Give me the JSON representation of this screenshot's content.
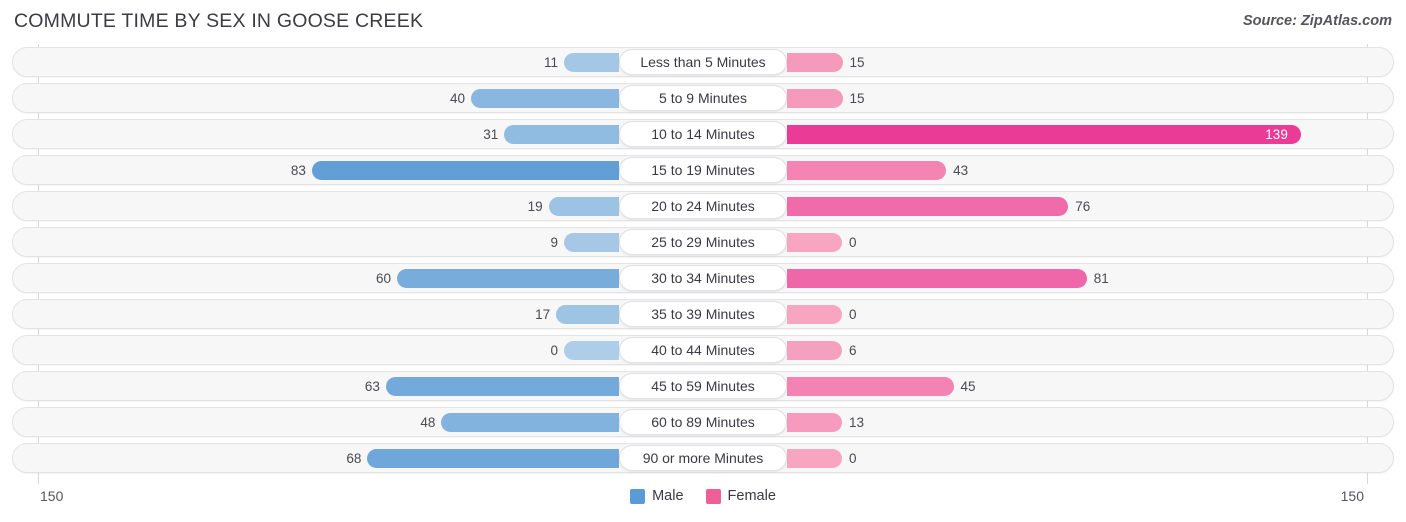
{
  "header": {
    "title": "COMMUTE TIME BY SEX IN GOOSE CREEK",
    "source": "Source: ZipAtlas.com"
  },
  "footer": {
    "axis_left": "150",
    "axis_right": "150"
  },
  "legend": [
    {
      "label": "Male",
      "color": "#5b9bd5"
    },
    {
      "label": "Female",
      "color": "#ef5f97"
    }
  ],
  "chart_data": {
    "type": "bar",
    "title": "COMMUTE TIME BY SEX IN GOOSE CREEK",
    "subtitle": "Source: ZipAtlas.com",
    "orientation": "horizontal-diverging",
    "xlabel": "",
    "ylabel": "",
    "axis_max": 150,
    "xlim": [
      150,
      150
    ],
    "grid": false,
    "legend_position": "bottom-center",
    "categories": [
      "Less than 5 Minutes",
      "5 to 9 Minutes",
      "10 to 14 Minutes",
      "15 to 19 Minutes",
      "20 to 24 Minutes",
      "25 to 29 Minutes",
      "30 to 34 Minutes",
      "35 to 39 Minutes",
      "40 to 44 Minutes",
      "45 to 59 Minutes",
      "60 to 89 Minutes",
      "90 or more Minutes"
    ],
    "series": [
      {
        "name": "Male",
        "direction": "left",
        "color": "#5b9bd5",
        "values": [
          11,
          40,
          31,
          83,
          19,
          9,
          60,
          17,
          0,
          63,
          48,
          68
        ]
      },
      {
        "name": "Female",
        "direction": "right",
        "color": "#ef5f97",
        "values": [
          15,
          15,
          139,
          43,
          76,
          0,
          81,
          0,
          6,
          45,
          13,
          0
        ]
      }
    ]
  }
}
